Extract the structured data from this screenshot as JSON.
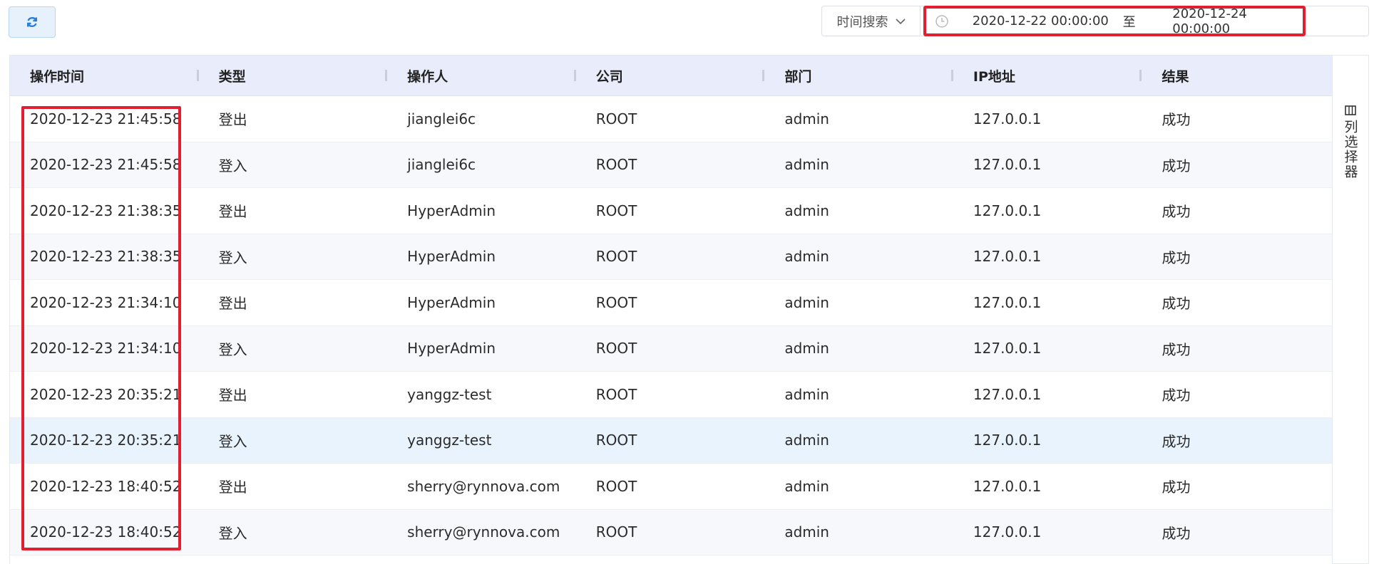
{
  "toolbar": {
    "refresh_icon": "refresh-icon",
    "search_mode_label": "时间搜索",
    "date_start": "2020-12-22 00:00:00",
    "date_separator": "至",
    "date_end": "2020-12-24 00:00:00"
  },
  "table": {
    "headers": [
      "操作时间",
      "类型",
      "操作人",
      "公司",
      "部门",
      "IP地址",
      "结果"
    ],
    "rows": [
      [
        "2020-12-23 21:45:58",
        "登出",
        "jianglei6c",
        "ROOT",
        "admin",
        "127.0.0.1",
        "成功"
      ],
      [
        "2020-12-23 21:45:58",
        "登入",
        "jianglei6c",
        "ROOT",
        "admin",
        "127.0.0.1",
        "成功"
      ],
      [
        "2020-12-23 21:38:35",
        "登出",
        "HyperAdmin",
        "ROOT",
        "admin",
        "127.0.0.1",
        "成功"
      ],
      [
        "2020-12-23 21:38:35",
        "登入",
        "HyperAdmin",
        "ROOT",
        "admin",
        "127.0.0.1",
        "成功"
      ],
      [
        "2020-12-23 21:34:10",
        "登出",
        "HyperAdmin",
        "ROOT",
        "admin",
        "127.0.0.1",
        "成功"
      ],
      [
        "2020-12-23 21:34:10",
        "登入",
        "HyperAdmin",
        "ROOT",
        "admin",
        "127.0.0.1",
        "成功"
      ],
      [
        "2020-12-23 20:35:21",
        "登出",
        "yanggz-test",
        "ROOT",
        "admin",
        "127.0.0.1",
        "成功"
      ],
      [
        "2020-12-23 20:35:21",
        "登入",
        "yanggz-test",
        "ROOT",
        "admin",
        "127.0.0.1",
        "成功"
      ],
      [
        "2020-12-23 18:40:52",
        "登出",
        "sherry@rynnova.com",
        "ROOT",
        "admin",
        "127.0.0.1",
        "成功"
      ],
      [
        "2020-12-23 18:40:52",
        "登入",
        "sherry@rynnova.com",
        "ROOT",
        "admin",
        "127.0.0.1",
        "成功"
      ]
    ]
  },
  "column_chooser": {
    "label": "列选择器"
  },
  "colors": {
    "header_bg": "#e9edfb",
    "highlight_border": "#e02030",
    "accent": "#2a7fd4"
  }
}
